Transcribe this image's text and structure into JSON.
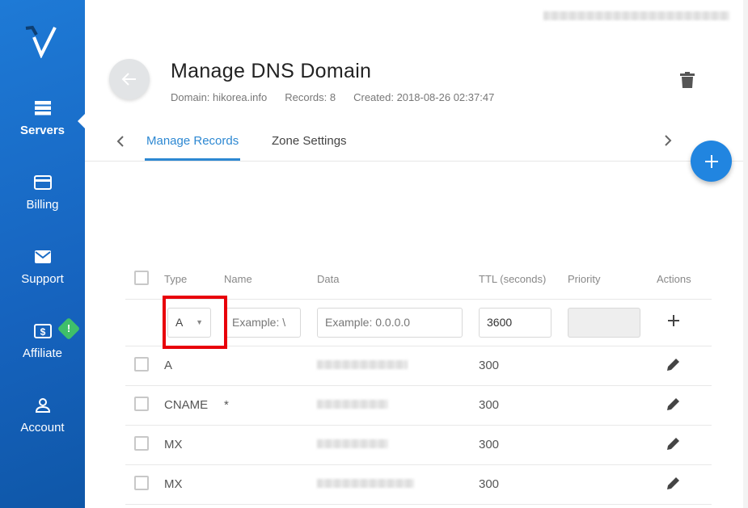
{
  "sidebar": {
    "items": [
      {
        "label": "Servers",
        "icon": "servers-icon",
        "active": true
      },
      {
        "label": "Billing",
        "icon": "credit-card-icon"
      },
      {
        "label": "Support",
        "icon": "envelope-icon"
      },
      {
        "label": "Affiliate",
        "icon": "dollar-icon",
        "badge": "!"
      },
      {
        "label": "Account",
        "icon": "user-icon"
      }
    ]
  },
  "header": {
    "title": "Manage DNS Domain",
    "domain": "Domain: hikorea.info",
    "records": "Records: 8",
    "created": "Created: 2018-08-26 02:37:47"
  },
  "tabs": [
    {
      "label": "Manage Records",
      "active": true
    },
    {
      "label": "Zone Settings"
    }
  ],
  "table": {
    "headers": [
      "Type",
      "Name",
      "Data",
      "TTL (seconds)",
      "Priority",
      "Actions"
    ],
    "new_record": {
      "type": "A",
      "name_placeholder": "Example: \\",
      "data_placeholder": "Example: 0.0.0.0",
      "ttl": "3600",
      "priority": ""
    },
    "rows": [
      {
        "type": "A",
        "name": "",
        "ttl": "300"
      },
      {
        "type": "CNAME",
        "name": "*",
        "ttl": "300"
      },
      {
        "type": "MX",
        "name": "",
        "ttl": "300"
      },
      {
        "type": "MX",
        "name": "",
        "ttl": "300"
      }
    ]
  },
  "colors": {
    "sidebar": "#1663be",
    "accent": "#2185e0",
    "highlight": "#e8000a",
    "badge": "#3fbf6a"
  }
}
